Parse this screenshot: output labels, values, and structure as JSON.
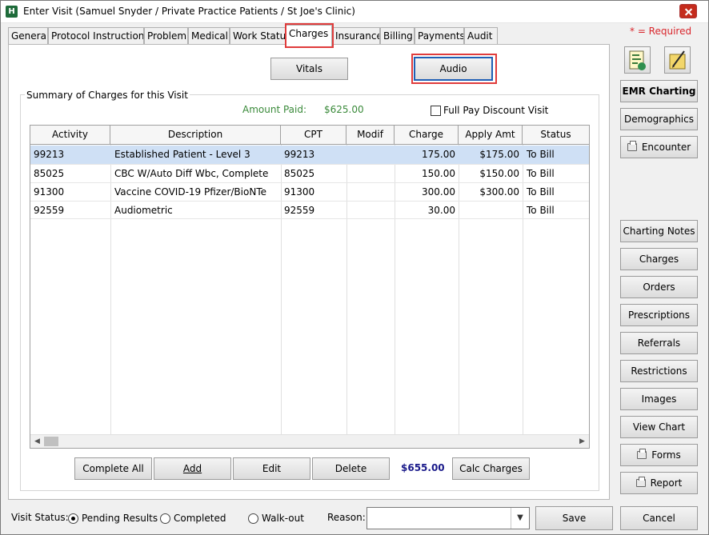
{
  "window": {
    "title": "Enter Visit (Samuel Snyder / Private Practice Patients / St Joe's Clinic)"
  },
  "tabs": [
    "General",
    "Protocol Instructions",
    "Problem",
    "Medical",
    "Work Status",
    "Charges",
    "Insurance",
    "Billing",
    "Payments",
    "Audit"
  ],
  "active_tab": "Charges",
  "required_note": "* = Required",
  "top_buttons": {
    "vitals": "Vitals",
    "audio": "Audio"
  },
  "summary": {
    "group_label": "Summary of Charges for this Visit",
    "amount_paid_label": "Amount Paid:",
    "amount_paid_value": "$625.00",
    "full_pay_label": "Full Pay Discount Visit",
    "full_pay_checked": false
  },
  "grid": {
    "columns": [
      "Activity",
      "Description",
      "CPT",
      "Modif",
      "Charge",
      "Apply Amt",
      "Status"
    ],
    "rows": [
      {
        "activity": "99213",
        "description": "Established Patient - Level 3",
        "cpt": "99213",
        "modif": "",
        "charge": "175.00",
        "apply": "$175.00",
        "status": "To Bill",
        "selected": true
      },
      {
        "activity": "85025",
        "description": "CBC W/Auto Diff Wbc, Complete",
        "cpt": "85025",
        "modif": "",
        "charge": "150.00",
        "apply": "$150.00",
        "status": "To Bill",
        "selected": false
      },
      {
        "activity": "91300",
        "description": "Vaccine COVID-19 Pfizer/BioNTe",
        "cpt": "91300",
        "modif": "",
        "charge": "300.00",
        "apply": "$300.00",
        "status": "To Bill",
        "selected": false
      },
      {
        "activity": "92559",
        "description": "Audiometric",
        "cpt": "92559",
        "modif": "",
        "charge": "30.00",
        "apply": "",
        "status": "To Bill",
        "selected": false
      }
    ]
  },
  "bottom_buttons": {
    "complete_all": "Complete All",
    "add": "Add",
    "edit": "Edit",
    "delete": "Delete",
    "calc": "Calc Charges"
  },
  "total": "$655.00",
  "sidebar": {
    "emr_charting": "EMR Charting",
    "demographics": "Demographics",
    "encounter": "Encounter",
    "charting_notes": "Charting Notes",
    "charges": "Charges",
    "orders": "Orders",
    "prescriptions": "Prescriptions",
    "referrals": "Referrals",
    "restrictions": "Restrictions",
    "images": "Images",
    "view_chart": "View Chart",
    "forms": "Forms",
    "report": "Report"
  },
  "footer": {
    "visit_status_label": "Visit Status:",
    "options": [
      "Pending Results",
      "Completed",
      "Walk-out"
    ],
    "selected_option": "Pending Results",
    "reason_label": "Reason:",
    "reason_value": "",
    "save": "Save",
    "cancel": "Cancel"
  },
  "colors": {
    "highlight": "#e03c3c",
    "required": "#d9252b",
    "amount_green": "#3a8a3a",
    "total_blue": "#1a1a8a",
    "selected_row": "#cfe0f5"
  },
  "icons": [
    "app-icon",
    "close-icon",
    "demographics-card-icon",
    "edit-pencil-icon",
    "printer-icon",
    "dropdown-arrow-icon",
    "scroll-left-icon",
    "scroll-right-icon"
  ]
}
